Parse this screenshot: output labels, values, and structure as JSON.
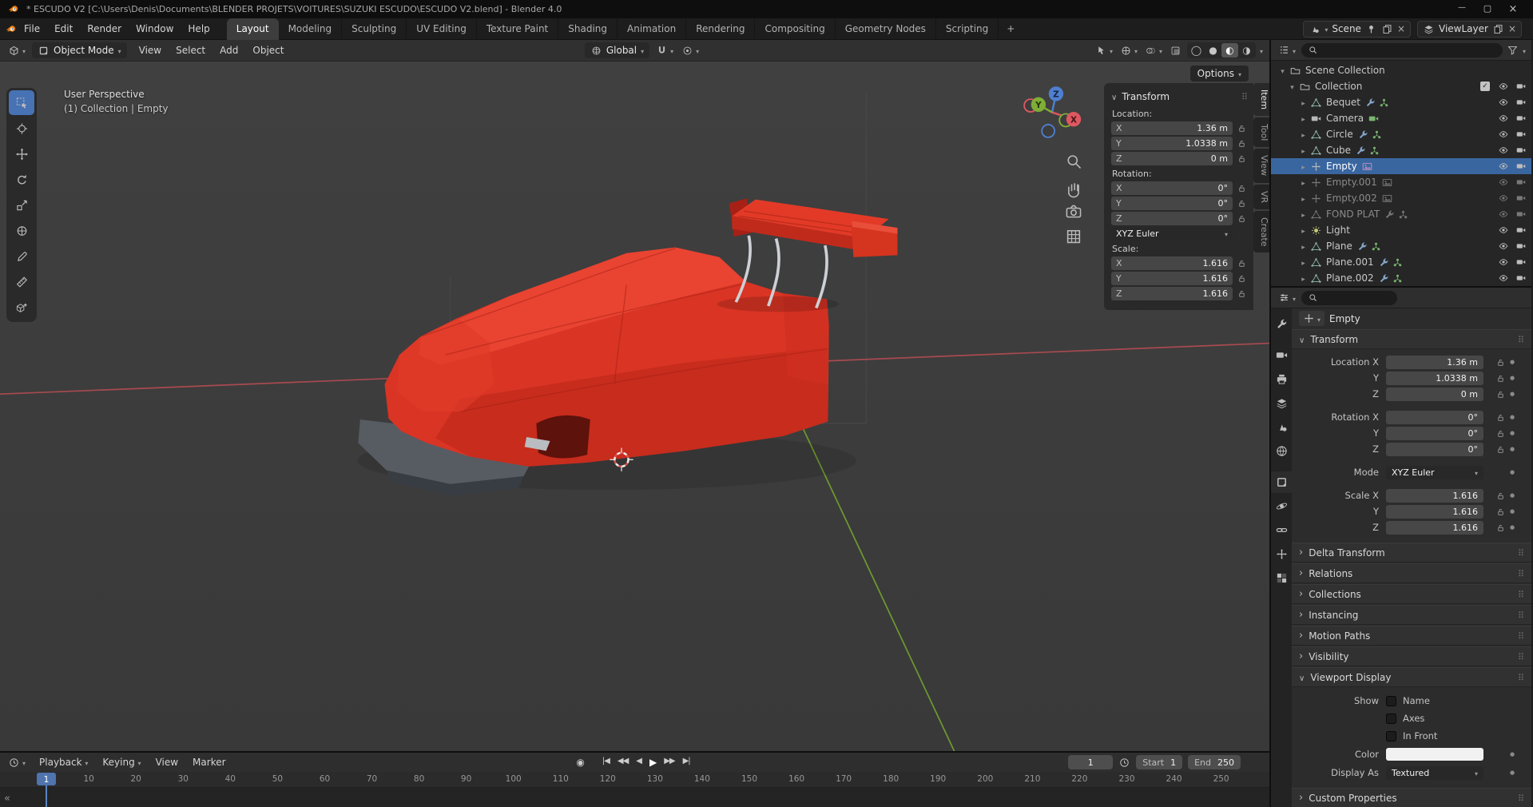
{
  "window": {
    "title": "* ESCUDO V2 [C:\\Users\\Denis\\Documents\\BLENDER PROJETS\\VOITURES\\SUZUKI ESCUDO\\ESCUDO V2.blend] - Blender 4.0"
  },
  "topbar": {
    "menus": [
      "File",
      "Edit",
      "Render",
      "Window",
      "Help"
    ],
    "workspaces": [
      "Layout",
      "Modeling",
      "Sculpting",
      "UV Editing",
      "Texture Paint",
      "Shading",
      "Animation",
      "Rendering",
      "Compositing",
      "Geometry Nodes",
      "Scripting"
    ],
    "active_workspace": "Layout",
    "add_workspace_label": "+",
    "scene_label": "Scene",
    "view_layer_label": "ViewLayer"
  },
  "viewport": {
    "header": {
      "mode": "Object Mode",
      "menus": [
        "View",
        "Select",
        "Add",
        "Object"
      ],
      "orientation": "Global",
      "shading": [
        "wireframe",
        "solid",
        "material",
        "rendered"
      ],
      "active_shading": "material"
    },
    "options_label": "Options",
    "overlay": {
      "perspective_label": "User Perspective",
      "context_label": "(1) Collection | Empty"
    },
    "toolbar": [
      "select-box",
      "cursor",
      "move",
      "rotate",
      "scale",
      "transform",
      "annotate",
      "measure",
      "add-cube"
    ],
    "gizmo": {
      "x": "X",
      "y": "Y",
      "z": "Z"
    }
  },
  "npanel": {
    "tabs": [
      "Item",
      "Tool",
      "View",
      "VR",
      "Create"
    ],
    "active_tab": "Item",
    "title": "Transform",
    "location_label": "Location:",
    "location": [
      {
        "axis": "X",
        "value": "1.36 m"
      },
      {
        "axis": "Y",
        "value": "1.0338 m"
      },
      {
        "axis": "Z",
        "value": "0 m"
      }
    ],
    "rotation_label": "Rotation:",
    "rotation": [
      {
        "axis": "X",
        "value": "0°"
      },
      {
        "axis": "Y",
        "value": "0°"
      },
      {
        "axis": "Z",
        "value": "0°"
      }
    ],
    "rotation_mode": "XYZ Euler",
    "scale_label": "Scale:",
    "scale": [
      {
        "axis": "X",
        "value": "1.616"
      },
      {
        "axis": "Y",
        "value": "1.616"
      },
      {
        "axis": "Z",
        "value": "1.616"
      }
    ]
  },
  "outliner": {
    "root_label": "Scene Collection",
    "collection_label": "Collection",
    "items": [
      {
        "label": "Bequet",
        "icon": "mesh",
        "extras": [
          "wrench",
          "nodes"
        ]
      },
      {
        "label": "Camera",
        "icon": "cam",
        "extras": [
          "cam-data"
        ]
      },
      {
        "label": "Circle",
        "icon": "mesh",
        "extras": [
          "wrench",
          "nodes"
        ]
      },
      {
        "label": "Cube",
        "icon": "mesh",
        "extras": [
          "wrench",
          "nodes"
        ]
      },
      {
        "label": "Empty",
        "icon": "empty",
        "extras": [
          "image"
        ],
        "selected": true
      },
      {
        "label": "Empty.001",
        "icon": "empty",
        "extras": [
          "image"
        ],
        "dimmed": true
      },
      {
        "label": "Empty.002",
        "icon": "empty",
        "extras": [
          "image"
        ],
        "dimmed": true
      },
      {
        "label": "FOND PLAT",
        "icon": "mesh",
        "extras": [
          "wrench",
          "nodes"
        ],
        "dimmed": true
      },
      {
        "label": "Light",
        "icon": "light",
        "extras": []
      },
      {
        "label": "Plane",
        "icon": "mesh",
        "extras": [
          "wrench",
          "nodes"
        ]
      },
      {
        "label": "Plane.001",
        "icon": "mesh",
        "extras": [
          "wrench",
          "nodes"
        ]
      },
      {
        "label": "Plane.002",
        "icon": "mesh",
        "extras": [
          "wrench",
          "nodes"
        ]
      }
    ]
  },
  "properties": {
    "tabs": [
      "tool",
      "render",
      "output",
      "view-layer",
      "scene",
      "world",
      "object",
      "physics",
      "constraints",
      "data",
      "texture"
    ],
    "active_tab": "object",
    "breadcrumb": "Empty",
    "transform_title": "Transform",
    "transform_rows": [
      {
        "label": "Location X",
        "value": "1.36 m"
      },
      {
        "label": "Y",
        "value": "1.0338 m"
      },
      {
        "label": "Z",
        "value": "0 m",
        "gap": true
      },
      {
        "label": "Rotation X",
        "value": "0°"
      },
      {
        "label": "Y",
        "value": "0°"
      },
      {
        "label": "Z",
        "value": "0°",
        "gap": true
      },
      {
        "label": "Mode",
        "value": "XYZ Euler",
        "dropdown": true,
        "gap": true
      },
      {
        "label": "Scale X",
        "value": "1.616"
      },
      {
        "label": "Y",
        "value": "1.616"
      },
      {
        "label": "Z",
        "value": "1.616"
      }
    ],
    "collapsed_panels": [
      "Delta Transform",
      "Relations",
      "Collections",
      "Instancing",
      "Motion Paths",
      "Visibility"
    ],
    "viewport_display": {
      "title": "Viewport Display",
      "show_label": "Show",
      "checkboxes": [
        "Name",
        "Axes",
        "In Front"
      ],
      "color_label": "Color",
      "display_as_label": "Display As",
      "display_as_value": "Textured"
    },
    "bottom_panels": [
      "Custom Properties"
    ]
  },
  "timeline": {
    "menus": [
      "Playback",
      "Keying",
      "View",
      "Marker"
    ],
    "transport": [
      "jump-start",
      "prev-keyframe",
      "play-reverse",
      "play",
      "next-keyframe",
      "jump-end"
    ],
    "current_frame": "1",
    "start_label": "Start",
    "start_value": "1",
    "end_label": "End",
    "end_value": "250",
    "playhead_frame": "1",
    "ticks": [
      10,
      20,
      30,
      40,
      50,
      60,
      70,
      80,
      90,
      100,
      110,
      120,
      130,
      140,
      150,
      160,
      170,
      180,
      190,
      200,
      210,
      220,
      230,
      240,
      250
    ]
  },
  "colors": {
    "accent_orange": "#e87d0d",
    "selection_blue": "#3a66a0",
    "car_red": "#d93424"
  }
}
